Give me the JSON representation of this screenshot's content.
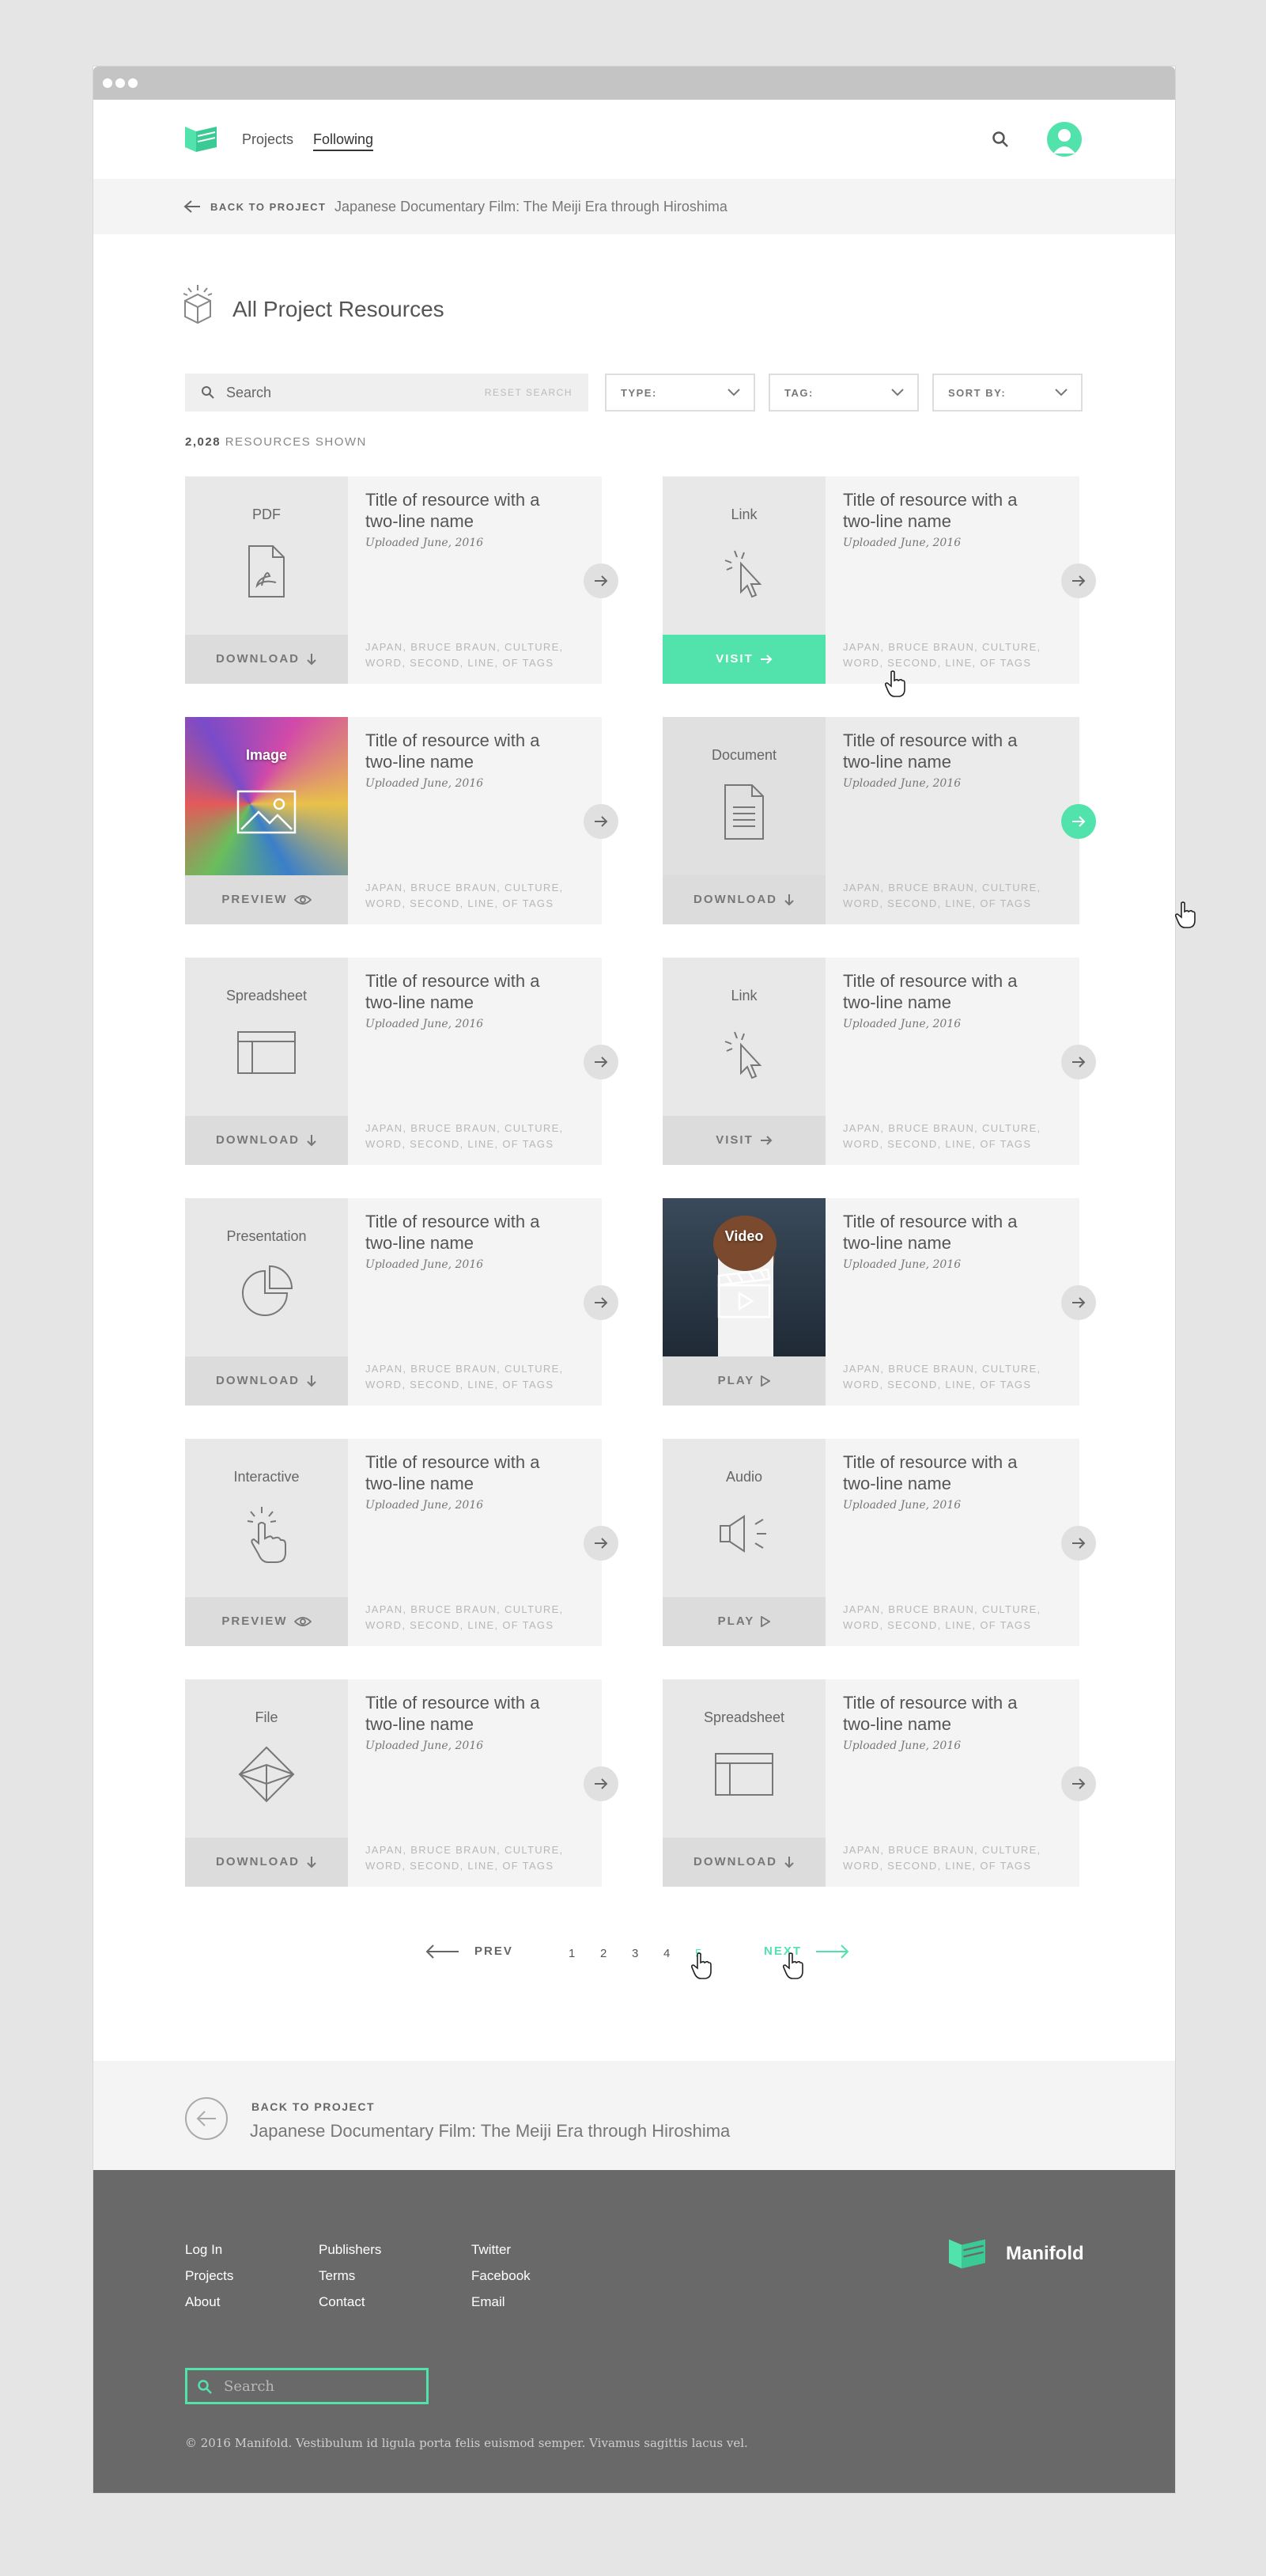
{
  "nav": {
    "projects": "Projects",
    "following": "Following"
  },
  "subbar": {
    "back_label": "BACK TO PROJECT",
    "project_title": "Japanese Documentary Film: The Meiji Era through Hiroshima"
  },
  "page": {
    "title": "All Project Resources"
  },
  "filters": {
    "search_placeholder": "Search",
    "reset": "RESET SEARCH",
    "type": "TYPE:",
    "tag": "TAG:",
    "sort": "SORT BY:"
  },
  "count": {
    "number": "2,028",
    "label": " RESOURCES SHOWN"
  },
  "cards": [
    {
      "type": "PDF",
      "icon": "pdf-icon",
      "action": "DOWNLOAD",
      "title": "Title of resource with a two-line name",
      "date": "Uploaded June, 2016",
      "tags": "JAPAN, BRUCE BRAUN, CULTURE, WORD, SECOND, LINE, OF TAGS"
    },
    {
      "type": "Link",
      "icon": "cursor-icon",
      "action": "VISIT",
      "title": "Title of resource with a two-line name",
      "date": "Uploaded June, 2016",
      "tags": "JAPAN, BRUCE BRAUN, CULTURE, WORD, SECOND, LINE, OF TAGS"
    },
    {
      "type": "Image",
      "icon": "image-icon",
      "action": "PREVIEW",
      "title": "Title of resource with a two-line name",
      "date": "Uploaded June, 2016",
      "tags": "JAPAN, BRUCE BRAUN, CULTURE, WORD, SECOND, LINE, OF TAGS"
    },
    {
      "type": "Document",
      "icon": "document-icon",
      "action": "DOWNLOAD",
      "title": "Title of resource with a two-line name",
      "date": "Uploaded June, 2016",
      "tags": "JAPAN, BRUCE BRAUN, CULTURE, WORD, SECOND, LINE, OF TAGS"
    },
    {
      "type": "Spreadsheet",
      "icon": "spreadsheet-icon",
      "action": "DOWNLOAD",
      "title": "Title of resource with a two-line name",
      "date": "Uploaded June, 2016",
      "tags": "JAPAN, BRUCE BRAUN, CULTURE, WORD, SECOND, LINE, OF TAGS"
    },
    {
      "type": "Link",
      "icon": "cursor-icon",
      "action": "VISIT",
      "title": "Title of resource with a two-line name",
      "date": "Uploaded June, 2016",
      "tags": "JAPAN, BRUCE BRAUN, CULTURE, WORD, SECOND, LINE, OF TAGS"
    },
    {
      "type": "Presentation",
      "icon": "pie-chart-icon",
      "action": "DOWNLOAD",
      "title": "Title of resource with a two-line name",
      "date": "Uploaded June, 2016",
      "tags": "JAPAN, BRUCE BRAUN, CULTURE, WORD, SECOND, LINE, OF TAGS"
    },
    {
      "type": "Video",
      "icon": "clapperboard-icon",
      "action": "PLAY",
      "title": "Title of resource with a two-line name",
      "date": "Uploaded June, 2016",
      "tags": "JAPAN, BRUCE BRAUN, CULTURE, WORD, SECOND, LINE, OF TAGS"
    },
    {
      "type": "Interactive",
      "icon": "hand-pointer-icon",
      "action": "PREVIEW",
      "title": "Title of resource with a two-line name",
      "date": "Uploaded June, 2016",
      "tags": "JAPAN, BRUCE BRAUN, CULTURE, WORD, SECOND, LINE, OF TAGS"
    },
    {
      "type": "Audio",
      "icon": "speaker-icon",
      "action": "PLAY",
      "title": "Title of resource with a two-line name",
      "date": "Uploaded June, 2016",
      "tags": "JAPAN, BRUCE BRAUN, CULTURE, WORD, SECOND, LINE, OF TAGS"
    },
    {
      "type": "File",
      "icon": "cube-icon",
      "action": "DOWNLOAD",
      "title": "Title of resource with a two-line name",
      "date": "Uploaded June, 2016",
      "tags": "JAPAN, BRUCE BRAUN, CULTURE, WORD, SECOND, LINE, OF TAGS"
    },
    {
      "type": "Spreadsheet",
      "icon": "spreadsheet-icon",
      "action": "DOWNLOAD",
      "title": "Title of resource with a two-line name",
      "date": "Uploaded June, 2016",
      "tags": "JAPAN, BRUCE BRAUN, CULTURE, WORD, SECOND, LINE, OF TAGS"
    }
  ],
  "pagination": {
    "prev": "PREV",
    "pages": [
      "1",
      "2",
      "3",
      "4",
      "5"
    ],
    "current": "5",
    "next": "NEXT"
  },
  "back_band": {
    "label": "BACK TO PROJECT",
    "title": "Japanese Documentary Film: The Meiji Era through Hiroshima"
  },
  "footer": {
    "col1": [
      "Log In",
      "Projects",
      "About"
    ],
    "col2": [
      "Publishers",
      "Terms",
      "Contact"
    ],
    "col3": [
      "Twitter",
      "Facebook",
      "Email"
    ],
    "brand": "Manifold",
    "search_placeholder": "Search",
    "copyright": "© 2016 Manifold. Vestibulum id ligula porta felis euismod semper. Vivamus sagittis lacus vel."
  },
  "colors": {
    "accent": "#52e3ac",
    "footer_bg": "#696969"
  }
}
